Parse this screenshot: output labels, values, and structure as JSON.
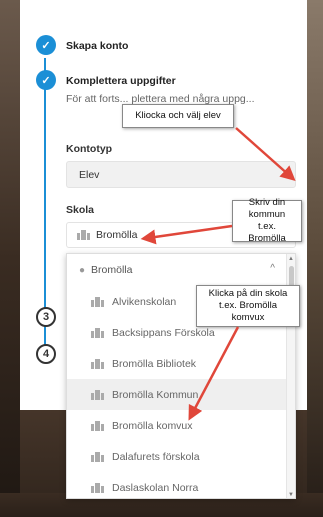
{
  "steps": [
    {
      "number": "",
      "title": "Skapa konto",
      "state": "done"
    },
    {
      "number": "",
      "title": "Komplettera uppgifter",
      "state": "done",
      "description": "För att forts... plettera med några uppg..."
    },
    {
      "number": "3",
      "state": "todo"
    },
    {
      "number": "4",
      "state": "todo"
    }
  ],
  "form": {
    "kontotyp_label": "Kontotyp",
    "kontotyp_value": "Elev",
    "skola_label": "Skola",
    "search_value": "Bromölla"
  },
  "dropdown": {
    "header": "Bromölla",
    "items": [
      "Alvikenskolan",
      "Backsippans Förskola",
      "Bromölla Bibliotek",
      "Bromölla Kommun",
      "Bromölla komvux",
      "Dalafurets förskola",
      "Daslaskolan Norra"
    ],
    "hover_index": 3
  },
  "callouts": {
    "c1": "Kliocka och välj elev",
    "c2": "Skriv din kommun t.ex. Bromölla",
    "c3": "Klicka på din skola t.ex. Bromölla komvux"
  },
  "colors": {
    "accent": "#1b8fd6",
    "arrow": "#e0473a"
  },
  "icons": {
    "check": "check-icon",
    "building": "building-icon",
    "pin": "location-pin-icon"
  }
}
